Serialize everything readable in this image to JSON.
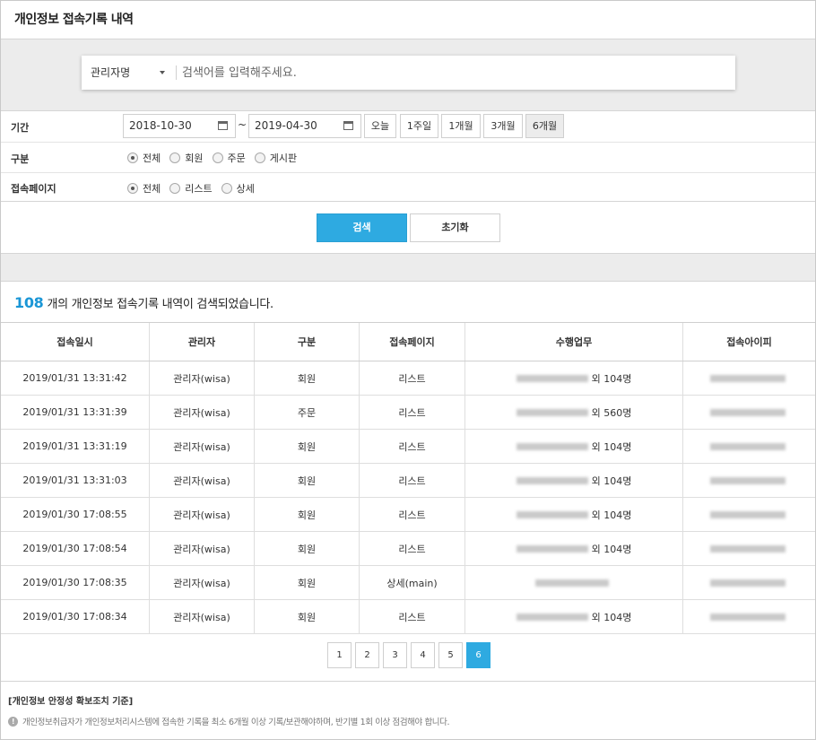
{
  "page": {
    "title": "개인정보 접속기록 내역"
  },
  "search": {
    "field_selected": "관리자명",
    "placeholder": "검색어를 입력해주세요."
  },
  "filters": {
    "period_label": "기간",
    "date_from": "2018-10-30",
    "date_separator": "~",
    "date_to": "2019-04-30",
    "quick_periods": [
      "오늘",
      "1주일",
      "1개월",
      "3개월",
      "6개월"
    ],
    "quick_active": "6개월",
    "type_label": "구분",
    "type_options": [
      "전체",
      "회원",
      "주문",
      "게시판"
    ],
    "type_selected": "전체",
    "page_label": "접속페이지",
    "page_options": [
      "전체",
      "리스트",
      "상세"
    ],
    "page_selected": "전체"
  },
  "buttons": {
    "search": "검색",
    "reset": "초기화"
  },
  "result": {
    "count": "108",
    "suffix": "개의 개인정보 접속기록 내역이 검색되었습니다."
  },
  "table": {
    "headers": [
      "접속일시",
      "관리자",
      "구분",
      "접속페이지",
      "수행업무",
      "접속아이피"
    ],
    "rows": [
      {
        "datetime": "2019/01/31 13:31:42",
        "admin": "관리자(wisa)",
        "type": "회원",
        "page": "리스트",
        "task": "외 104명"
      },
      {
        "datetime": "2019/01/31 13:31:39",
        "admin": "관리자(wisa)",
        "type": "주문",
        "page": "리스트",
        "task": "외 560명"
      },
      {
        "datetime": "2019/01/31 13:31:19",
        "admin": "관리자(wisa)",
        "type": "회원",
        "page": "리스트",
        "task": "외 104명"
      },
      {
        "datetime": "2019/01/31 13:31:03",
        "admin": "관리자(wisa)",
        "type": "회원",
        "page": "리스트",
        "task": "외 104명"
      },
      {
        "datetime": "2019/01/30 17:08:55",
        "admin": "관리자(wisa)",
        "type": "회원",
        "page": "리스트",
        "task": "외 104명"
      },
      {
        "datetime": "2019/01/30 17:08:54",
        "admin": "관리자(wisa)",
        "type": "회원",
        "page": "리스트",
        "task": "외 104명"
      },
      {
        "datetime": "2019/01/30 17:08:35",
        "admin": "관리자(wisa)",
        "type": "회원",
        "page": "상세(main)",
        "task": ""
      },
      {
        "datetime": "2019/01/30 17:08:34",
        "admin": "관리자(wisa)",
        "type": "회원",
        "page": "리스트",
        "task": "외 104명"
      }
    ]
  },
  "pagination": {
    "pages": [
      "1",
      "2",
      "3",
      "4",
      "5",
      "6"
    ],
    "current": "6"
  },
  "notice": {
    "title": "[개인정보 안정성 확보조치 기준]",
    "icon": "info-icon",
    "text": "개인정보취급자가 개인정보처리시스템에 접속한 기록을 최소 6개월 이상 기록/보관해야하며, 반기별 1회 이상 점검해야 합니다."
  },
  "colors": {
    "accent": "#2eaae1",
    "count": "#1a96d6",
    "panel_bg": "#ececec"
  }
}
